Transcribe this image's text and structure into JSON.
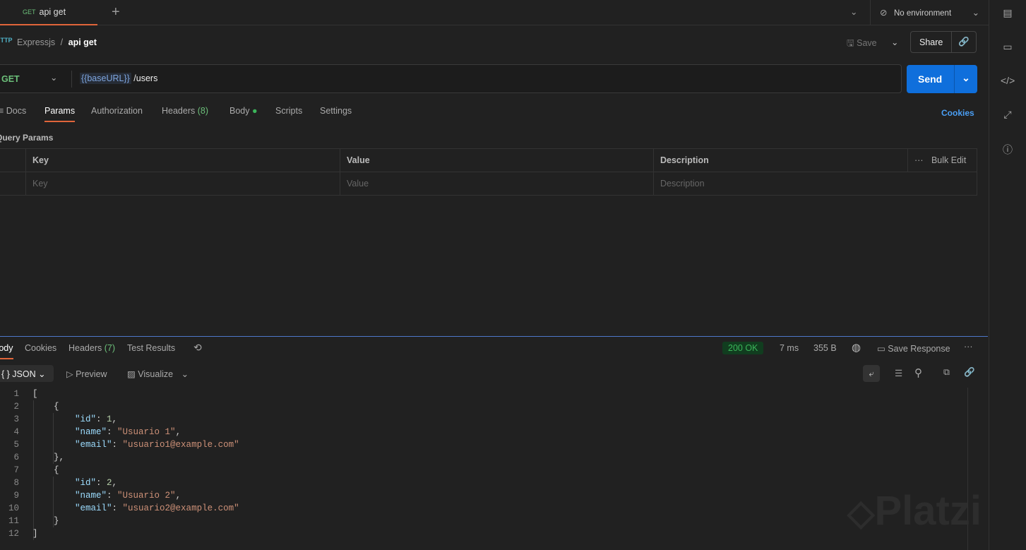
{
  "tab": {
    "method": "GET",
    "title": "api get"
  },
  "env": {
    "label": "No environment"
  },
  "breadcrumb": {
    "collection": "Expressjs",
    "separator": "/",
    "request": "api get",
    "icon": "HTTP"
  },
  "toolbar": {
    "save": "Save",
    "share": "Share"
  },
  "request": {
    "method": "GET",
    "variable": "{{baseURL}}",
    "path": "/users",
    "send": "Send"
  },
  "req_tabs": [
    "Docs",
    "Params",
    "Authorization",
    "Headers",
    "(8)",
    "Body",
    "Scripts",
    "Settings"
  ],
  "cookies": "Cookies",
  "query": {
    "title": "Query Params",
    "headers": [
      "Key",
      "Value",
      "Description"
    ],
    "bulk_edit": "Bulk Edit",
    "placeholders": [
      "Key",
      "Value",
      "Description"
    ]
  },
  "resp_tabs": [
    "Body",
    "Cookies",
    "Headers",
    "(7)",
    "Test Results"
  ],
  "status": {
    "code": "200 OK",
    "time": "7 ms",
    "size": "355 B",
    "save_response": "Save Response",
    "color": "#3bb55a"
  },
  "view": {
    "format": "JSON",
    "preview": "Preview",
    "visualize": "Visualize"
  },
  "code_lines": [
    [
      [
        "p",
        "["
      ]
    ],
    [
      [
        "p",
        "    {"
      ]
    ],
    [
      [
        "k",
        "        \"id\""
      ],
      [
        "p",
        ": "
      ],
      [
        "n",
        "1"
      ],
      [
        "p",
        ","
      ]
    ],
    [
      [
        "k",
        "        \"name\""
      ],
      [
        "p",
        ": "
      ],
      [
        "s",
        "\"Usuario 1\""
      ],
      [
        "p",
        ","
      ]
    ],
    [
      [
        "k",
        "        \"email\""
      ],
      [
        "p",
        ": "
      ],
      [
        "s",
        "\"usuario1@example.com\""
      ]
    ],
    [
      [
        "p",
        "    },"
      ]
    ],
    [
      [
        "p",
        "    {"
      ]
    ],
    [
      [
        "k",
        "        \"id\""
      ],
      [
        "p",
        ": "
      ],
      [
        "n",
        "2"
      ],
      [
        "p",
        ","
      ]
    ],
    [
      [
        "k",
        "        \"name\""
      ],
      [
        "p",
        ": "
      ],
      [
        "s",
        "\"Usuario 2\""
      ],
      [
        "p",
        ","
      ]
    ],
    [
      [
        "k",
        "        \"email\""
      ],
      [
        "p",
        ": "
      ],
      [
        "s",
        "\"usuario2@example.com\""
      ]
    ],
    [
      [
        "p",
        "    }"
      ]
    ],
    [
      [
        "p",
        "]"
      ]
    ]
  ],
  "watermark": "Platzi"
}
